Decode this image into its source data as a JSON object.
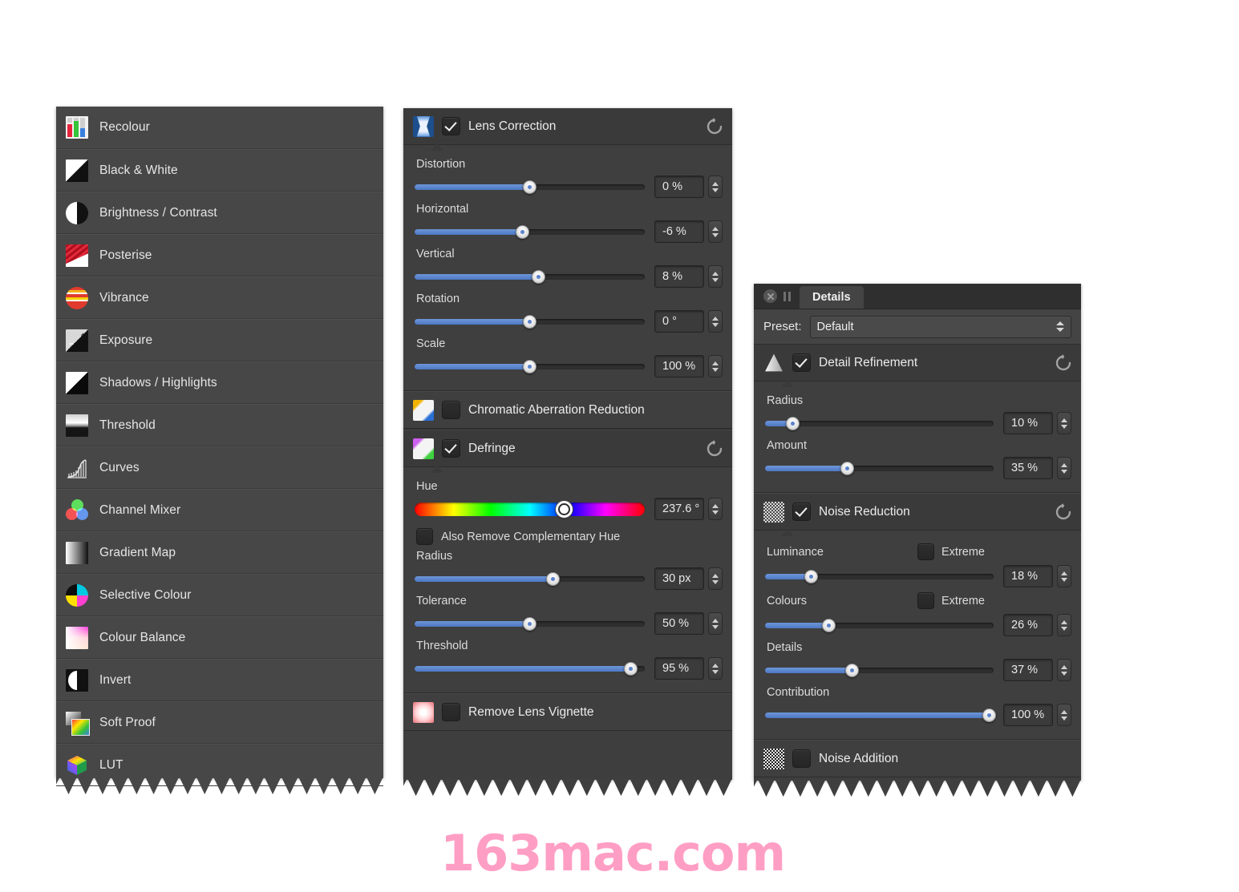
{
  "adjustments_panel": {
    "name": "adjustments-list",
    "items": [
      {
        "label": "Recolour",
        "icon": "recolour-icon"
      },
      {
        "label": "Black & White",
        "icon": "black-white-icon"
      },
      {
        "label": "Brightness / Contrast",
        "icon": "brightness-contrast-icon"
      },
      {
        "label": "Posterise",
        "icon": "posterise-icon"
      },
      {
        "label": "Vibrance",
        "icon": "vibrance-icon"
      },
      {
        "label": "Exposure",
        "icon": "exposure-icon"
      },
      {
        "label": "Shadows / Highlights",
        "icon": "shadows-highlights-icon"
      },
      {
        "label": "Threshold",
        "icon": "threshold-icon"
      },
      {
        "label": "Curves",
        "icon": "curves-icon"
      },
      {
        "label": "Channel Mixer",
        "icon": "channel-mixer-icon"
      },
      {
        "label": "Gradient Map",
        "icon": "gradient-map-icon"
      },
      {
        "label": "Selective Colour",
        "icon": "selective-colour-icon"
      },
      {
        "label": "Colour Balance",
        "icon": "colour-balance-icon"
      },
      {
        "label": "Invert",
        "icon": "invert-icon"
      },
      {
        "label": "Soft Proof",
        "icon": "soft-proof-icon"
      },
      {
        "label": "LUT",
        "icon": "lut-icon"
      }
    ]
  },
  "lens_panel": {
    "lens_correction": {
      "title": "Lens Correction",
      "checked": true,
      "icon": "pincushion-icon",
      "reset_icon": "reset-icon",
      "controls": [
        {
          "label": "Distortion",
          "value": "0 %",
          "fill_pct": 50,
          "thumb_pct": 50
        },
        {
          "label": "Horizontal",
          "value": "-6 %",
          "fill_pct": 47,
          "thumb_pct": 47
        },
        {
          "label": "Vertical",
          "value": "8 %",
          "fill_pct": 54,
          "thumb_pct": 54
        },
        {
          "label": "Rotation",
          "value": "0 °",
          "fill_pct": 50,
          "thumb_pct": 50
        },
        {
          "label": "Scale",
          "value": "100 %",
          "fill_pct": 50,
          "thumb_pct": 50
        }
      ]
    },
    "chromatic_aberration": {
      "title": "Chromatic Aberration Reduction",
      "checked": false,
      "icon": "chromatic-aberration-icon"
    },
    "defringe": {
      "title": "Defringe",
      "checked": true,
      "icon": "defringe-icon",
      "reset_icon": "reset-icon",
      "hue": {
        "label": "Hue",
        "value": "237.6 °",
        "thumb_pct": 65
      },
      "complementary": {
        "label": "Also Remove Complementary Hue",
        "checked": false
      },
      "controls": [
        {
          "label": "Radius",
          "value": "30 px",
          "fill_pct": 60,
          "thumb_pct": 60
        },
        {
          "label": "Tolerance",
          "value": "50 %",
          "fill_pct": 50,
          "thumb_pct": 50
        },
        {
          "label": "Threshold",
          "value": "95 %",
          "fill_pct": 94,
          "thumb_pct": 94
        }
      ]
    },
    "lens_vignette": {
      "title": "Remove Lens Vignette",
      "checked": false,
      "icon": "lens-vignette-icon"
    }
  },
  "details_panel": {
    "window_title": "Details",
    "close_icon": "close-icon",
    "pause_icon": "pause-icon",
    "preset": {
      "label": "Preset:",
      "value": "Default"
    },
    "detail_refinement": {
      "title": "Detail Refinement",
      "checked": true,
      "icon": "triangle-gradient-icon",
      "reset_icon": "reset-icon",
      "controls": [
        {
          "label": "Radius",
          "value": "10 %",
          "fill_pct": 12,
          "thumb_pct": 12
        },
        {
          "label": "Amount",
          "value": "35 %",
          "fill_pct": 36,
          "thumb_pct": 36
        }
      ]
    },
    "noise_reduction": {
      "title": "Noise Reduction",
      "checked": true,
      "icon": "noise-icon",
      "reset_icon": "reset-icon",
      "controls": [
        {
          "label": "Luminance",
          "value": "18 %",
          "fill_pct": 20,
          "thumb_pct": 20,
          "extreme_label": "Extreme",
          "extreme_checked": false
        },
        {
          "label": "Colours",
          "value": "26 %",
          "fill_pct": 28,
          "thumb_pct": 28,
          "extreme_label": "Extreme",
          "extreme_checked": false
        },
        {
          "label": "Details",
          "value": "37 %",
          "fill_pct": 38,
          "thumb_pct": 38
        },
        {
          "label": "Contribution",
          "value": "100 %",
          "fill_pct": 98,
          "thumb_pct": 98
        }
      ]
    },
    "noise_addition": {
      "title": "Noise Addition",
      "checked": false,
      "icon": "noise-addition-icon"
    }
  },
  "watermark": {
    "text": "163mac.com",
    "color": "#ff9ec4"
  }
}
